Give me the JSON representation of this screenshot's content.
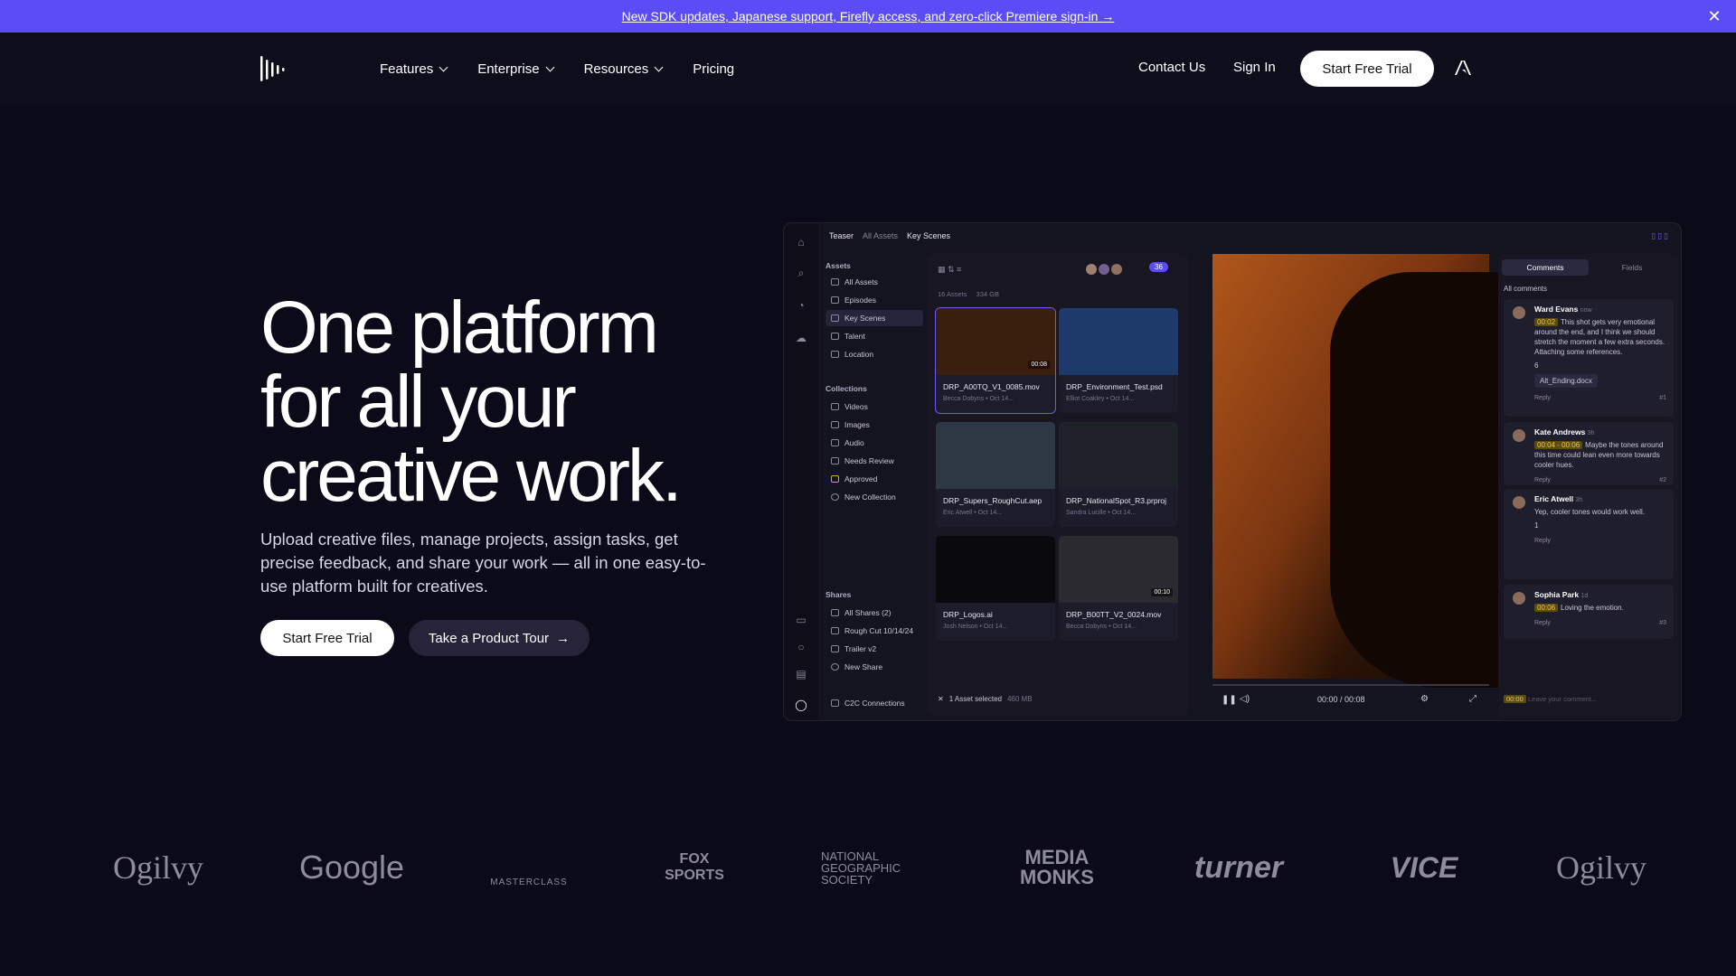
{
  "banner": {
    "text": "New SDK updates, Japanese support, Firefly access, and zero-click Premiere sign-in →",
    "close": "✕"
  },
  "nav": {
    "menu": [
      "Features",
      "Enterprise",
      "Resources",
      "Pricing"
    ],
    "contact": "Contact Us",
    "signin": "Sign In",
    "trial": "Start Free Trial"
  },
  "hero": {
    "title_lines": [
      "One platform",
      "for all your",
      "creative work."
    ],
    "subtitle": "Upload creative files, manage projects, assign tasks, get precise feedback, and share your work — all in one easy-to-use platform built for creatives.",
    "primary": "Start Free Trial",
    "secondary": "Take a Product Tour",
    "secondary_arrow": "→"
  },
  "app": {
    "breadcrumb": {
      "project": "Teaser",
      "root": "All Assets",
      "folder": "Key Scenes"
    },
    "sidebar": {
      "assets_title": "Assets",
      "assets": [
        "All Assets",
        "Episodes",
        "Key Scenes",
        "Talent",
        "Location"
      ],
      "collections_title": "Collections",
      "collections": [
        "Videos",
        "Images",
        "Audio",
        "Needs Review",
        "Approved",
        "New Collection"
      ],
      "shares_title": "Shares",
      "shares": [
        "All Shares (2)",
        "Rough Cut 10/14/24",
        "Trailer v2",
        "New Share"
      ],
      "c2c": "C2C Connections"
    },
    "grid": {
      "count": "16 Assets",
      "size": "334 GB",
      "members": "36",
      "footer": "1 Asset selected",
      "footer_size": "460 MB",
      "items": [
        {
          "name": "DRP_A00TQ_V1_0085.mov",
          "meta": "Becca Dobyns  •  Oct 14...",
          "dur": "00:08",
          "color": "#3a1e0e"
        },
        {
          "name": "DRP_Environment_Test.psd",
          "meta": "Elliot Coakley  •  Oct 14...",
          "dur": "",
          "color": "#1e3a6a"
        },
        {
          "name": "DRP_Supers_RoughCut.aep",
          "meta": "Eric Atwell  •  Oct 14...",
          "dur": "",
          "color": "#2e3844"
        },
        {
          "name": "DRP_NationalSpot_R3.prproj",
          "meta": "Sandra Lucille  •  Oct 14...",
          "dur": "",
          "color": "#1e2228"
        },
        {
          "name": "DRP_Logos.ai",
          "meta": "Josh Nelson  •  Oct 14...",
          "dur": "",
          "color": "#0a0a0e"
        },
        {
          "name": "DRP_B00TT_V2_0024.mov",
          "meta": "Becca Dobyns  •  Oct 14...",
          "dur": "00:10",
          "color": "#2a2a30"
        }
      ]
    },
    "player": {
      "time": "00:00 / 00:08"
    },
    "comments": {
      "tabs": [
        "Comments",
        "Fields"
      ],
      "filter": "All comments",
      "items": [
        {
          "name": "Ward Evans",
          "when": "now",
          "ts": "00:02",
          "text": "This shot gets very emotional around the end, and I think we should stretch the moment a few extra seconds. Attaching some references.",
          "reply": "Reply",
          "num": "#1",
          "attach": "Alt_Ending.docx",
          "react": "6"
        },
        {
          "name": "Kate Andrews",
          "when": "3h",
          "ts": "00:04 - 00:06",
          "text": "Maybe the tones around this time could lean even more towards cooler hues.",
          "reply": "Reply",
          "num": "#2"
        },
        {
          "name": "Eric Atwell",
          "when": "3h",
          "ts": "",
          "text": "Yep, cooler tones would work well.",
          "reply": "Reply",
          "num": "",
          "react": "1"
        },
        {
          "name": "Sophia Park",
          "when": "1d",
          "ts": "00:06",
          "text": "Loving the emotion.",
          "reply": "Reply",
          "num": "#3"
        }
      ],
      "input_ts": "00:00",
      "input_placeholder": "Leave your comment..."
    }
  },
  "logos": [
    "Ogilvy",
    "Google",
    "MASTERCLASS",
    "FOX SPORTS",
    "NATIONAL GEOGRAPHIC SOCIETY",
    "MEDIA MONKS",
    "turner",
    "VICE",
    "Ogilvy"
  ]
}
